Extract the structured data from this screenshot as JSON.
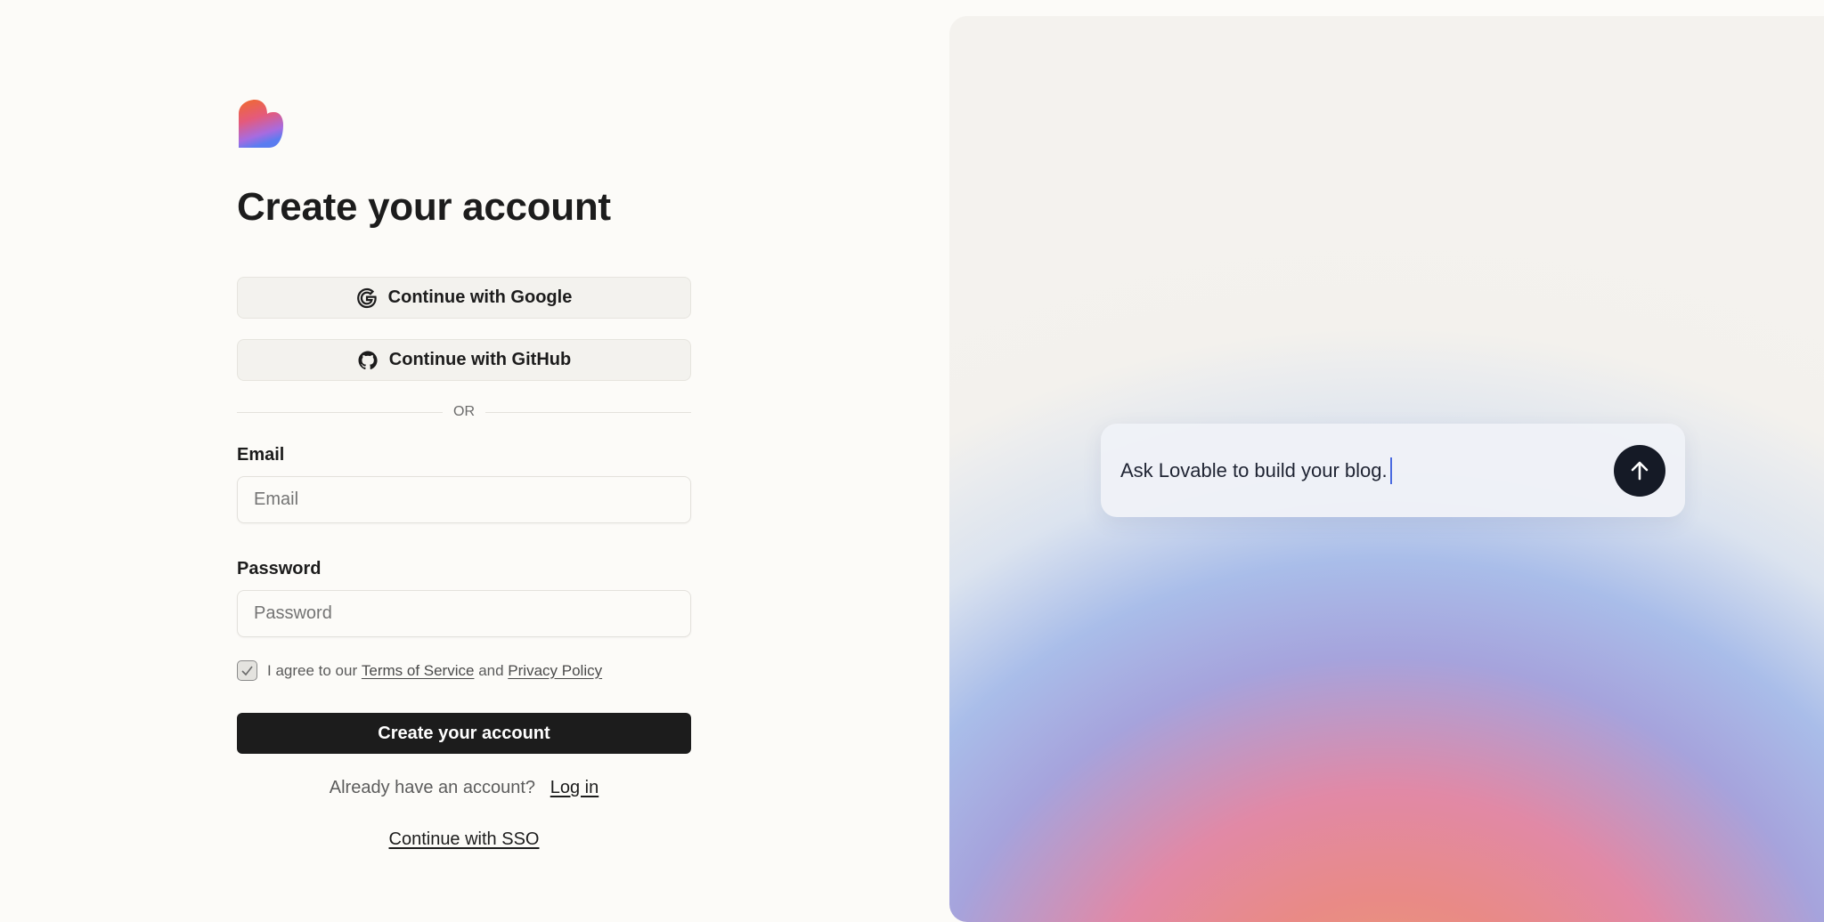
{
  "brand": {
    "logo_icon": "lovable-heart-icon"
  },
  "page": {
    "title": "Create your account"
  },
  "oauth": {
    "google_label": "Continue with Google",
    "github_label": "Continue with GitHub"
  },
  "divider": {
    "label": "OR"
  },
  "email": {
    "label": "Email",
    "placeholder": "Email",
    "value": ""
  },
  "password": {
    "label": "Password",
    "placeholder": "Password",
    "value": ""
  },
  "agreement": {
    "prefix": "I agree to our",
    "terms_label": "Terms of Service",
    "conjunction": "and",
    "privacy_label": "Privacy Policy",
    "checked": true
  },
  "submit": {
    "label": "Create your account"
  },
  "login": {
    "prompt": "Already have an account?",
    "link_label": "Log in"
  },
  "sso": {
    "label": "Continue with SSO"
  },
  "hero": {
    "prompt_text": "Ask Lovable to build your blog.",
    "send_icon": "arrow-up-icon"
  },
  "colors": {
    "primary": "#1c1c1c",
    "background": "#fcfbf8",
    "send_button": "#151a26"
  }
}
